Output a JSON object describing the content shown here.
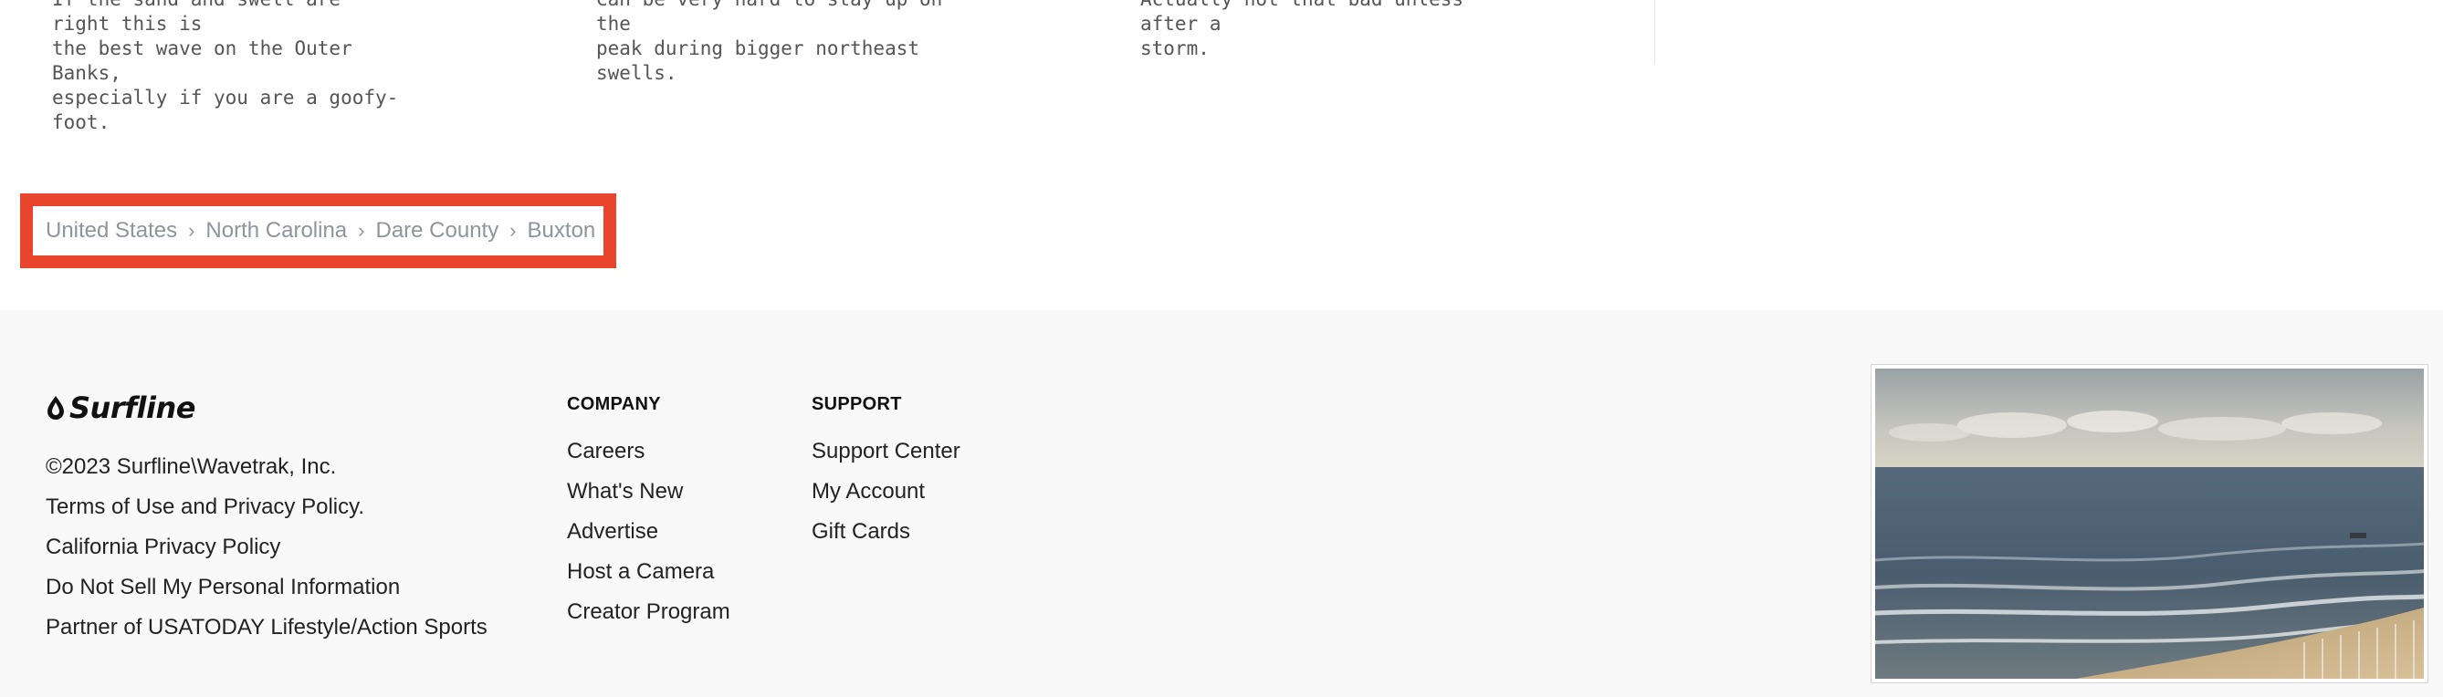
{
  "spots": [
    {
      "description": "If the sand and swell are right this is\nthe best wave on the Outer Banks,\nespecially if you are a goofy-foot."
    },
    {
      "description": "Can be very hard to stay up on the\npeak during bigger northeast swells."
    },
    {
      "description": "Actually not that bad unless after a\nstorm."
    }
  ],
  "breadcrumb": {
    "items": [
      "United States",
      "North Carolina",
      "Dare County",
      "Buxton"
    ],
    "separator": "›",
    "highlight_color": "#e8452c"
  },
  "footer": {
    "brand": "Surfline",
    "legal": [
      "©2023 Surfline\\Wavetrak, Inc.",
      "Terms of Use and Privacy Policy.",
      "California Privacy Policy",
      "Do Not Sell My Personal Information",
      "Partner of USATODAY Lifestyle/Action Sports"
    ],
    "company": {
      "heading": "COMPANY",
      "links": [
        "Careers",
        "What's New",
        "Advertise",
        "Host a Camera",
        "Creator Program"
      ]
    },
    "support": {
      "heading": "SUPPORT",
      "links": [
        "Support Center",
        "My Account",
        "Gift Cards"
      ]
    }
  }
}
